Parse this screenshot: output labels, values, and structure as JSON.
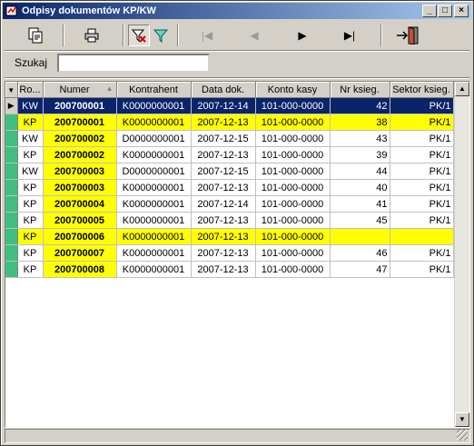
{
  "window": {
    "title": "Odpisy dokumentów KP/KW",
    "minimize": "_",
    "maximize": "□",
    "close": "×"
  },
  "search": {
    "label": "Szukaj",
    "value": "",
    "placeholder": ""
  },
  "table": {
    "columns": [
      "Ro...",
      "Numer",
      "Kontrahent",
      "Data dok.",
      "Konto kasy",
      "Nr ksieg.",
      "Sektor ksieg."
    ],
    "rows": [
      {
        "rodzaj": "KW",
        "numer": "200700001",
        "kontrahent": "K0000000001",
        "data": "2007-12-14",
        "konto": "101-000-0000",
        "nr": "42",
        "sektor": "PK/1",
        "style": "sel"
      },
      {
        "rodzaj": "KP",
        "numer": "200700001",
        "kontrahent": "K0000000001",
        "data": "2007-12-13",
        "konto": "101-000-0000",
        "nr": "38",
        "sektor": "PK/1",
        "style": "yellow"
      },
      {
        "rodzaj": "KW",
        "numer": "200700002",
        "kontrahent": "D0000000001",
        "data": "2007-12-15",
        "konto": "101-000-0000",
        "nr": "43",
        "sektor": "PK/1",
        "style": "white"
      },
      {
        "rodzaj": "KP",
        "numer": "200700002",
        "kontrahent": "K0000000001",
        "data": "2007-12-13",
        "konto": "101-000-0000",
        "nr": "39",
        "sektor": "PK/1",
        "style": "white"
      },
      {
        "rodzaj": "KW",
        "numer": "200700003",
        "kontrahent": "D0000000001",
        "data": "2007-12-15",
        "konto": "101-000-0000",
        "nr": "44",
        "sektor": "PK/1",
        "style": "white"
      },
      {
        "rodzaj": "KP",
        "numer": "200700003",
        "kontrahent": "K0000000001",
        "data": "2007-12-13",
        "konto": "101-000-0000",
        "nr": "40",
        "sektor": "PK/1",
        "style": "white"
      },
      {
        "rodzaj": "KP",
        "numer": "200700004",
        "kontrahent": "K0000000001",
        "data": "2007-12-14",
        "konto": "101-000-0000",
        "nr": "41",
        "sektor": "PK/1",
        "style": "white"
      },
      {
        "rodzaj": "KP",
        "numer": "200700005",
        "kontrahent": "K0000000001",
        "data": "2007-12-13",
        "konto": "101-000-0000",
        "nr": "45",
        "sektor": "PK/1",
        "style": "white"
      },
      {
        "rodzaj": "KP",
        "numer": "200700006",
        "kontrahent": "K0000000001",
        "data": "2007-12-13",
        "konto": "101-000-0000",
        "nr": "",
        "sektor": "",
        "style": "yellow"
      },
      {
        "rodzaj": "KP",
        "numer": "200700007",
        "kontrahent": "K0000000001",
        "data": "2007-12-13",
        "konto": "101-000-0000",
        "nr": "46",
        "sektor": "PK/1",
        "style": "white"
      },
      {
        "rodzaj": "KP",
        "numer": "200700008",
        "kontrahent": "K0000000001",
        "data": "2007-12-13",
        "konto": "101-000-0000",
        "nr": "47",
        "sektor": "PK/1",
        "style": "white"
      }
    ]
  },
  "colors": {
    "highlight": "#ffff00",
    "selection": "#0a246a",
    "indicator": "#3fbf7f"
  }
}
